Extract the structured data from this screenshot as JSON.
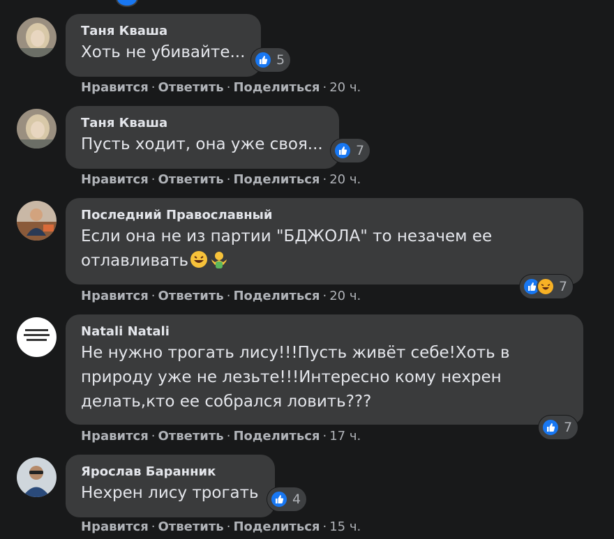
{
  "actions": {
    "like": "Нравится",
    "reply": "Ответить",
    "share": "Поделиться",
    "separator": "·"
  },
  "comments": [
    {
      "author": "Таня Кваша",
      "text": "Хоть не убивайте...",
      "reactions": [
        "like-icon"
      ],
      "reaction_count": "5",
      "time": "20 ч."
    },
    {
      "author": "Таня Кваша",
      "text": "Пусть ходит, она уже своя...",
      "reactions": [
        "like-icon"
      ],
      "reaction_count": "7",
      "time": "20 ч."
    },
    {
      "author": "Последний Православный",
      "text_lines": [
        "Если она не из партии \"БДЖОЛА\" то незачем ее",
        "отлавливать"
      ],
      "reactions": [
        "like-icon",
        "haha-icon"
      ],
      "reaction_count": "7",
      "time": "20 ч."
    },
    {
      "author": "Natali Natali",
      "text_lines": [
        "Не нужно трогать лису!!!Пусть живёт себе!Хоть в",
        "природу уже не лезьте!!!Интересно кому нехрен",
        "делать,кто ее собрался ловить???"
      ],
      "reactions": [
        "like-icon"
      ],
      "reaction_count": "7",
      "time": "17 ч."
    },
    {
      "author": "Ярослав Баранник",
      "text": "Нехрен лису трогать",
      "reactions": [
        "like-icon"
      ],
      "reaction_count": "4",
      "time": "15 ч."
    }
  ],
  "colors": {
    "background": "#18191a",
    "bubble": "#3a3b3c",
    "text": "#e4e6eb",
    "secondary_text": "#b0b3b8",
    "like_blue": "#1877f2",
    "haha_yellow": "#f7b125"
  }
}
